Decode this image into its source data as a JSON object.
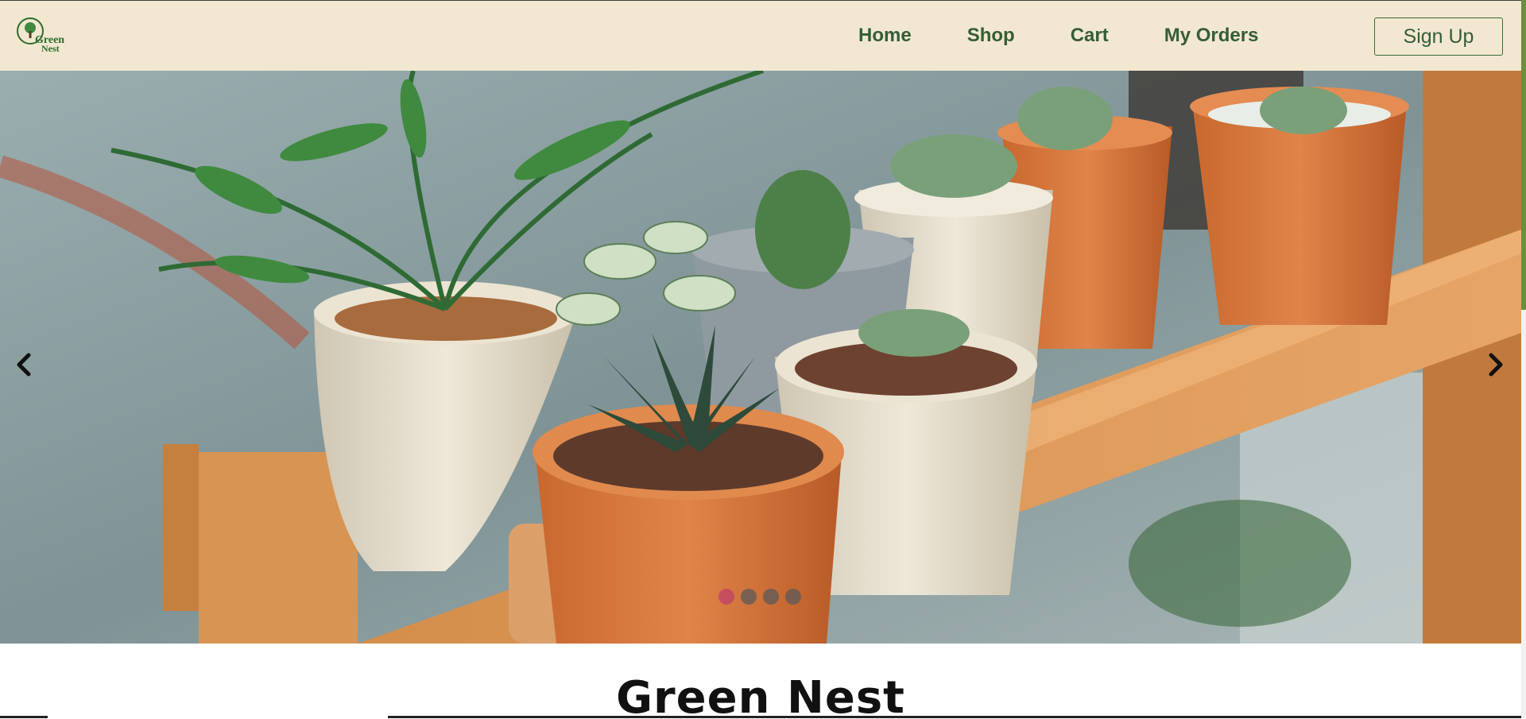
{
  "brand": {
    "logo_line1": "Green",
    "logo_line2": "Nest",
    "primary_color": "#355d35",
    "nav_bg": "#f2e8d1"
  },
  "nav": {
    "items": [
      {
        "label": "Home"
      },
      {
        "label": "Shop"
      },
      {
        "label": "Cart"
      },
      {
        "label": "My Orders"
      }
    ],
    "signup_label": "Sign Up"
  },
  "carousel": {
    "prev_icon": "chevron-left-icon",
    "next_icon": "chevron-right-icon",
    "slide_count": 4,
    "active_slide": 1,
    "active_dot_color": "#c54e5e"
  },
  "main": {
    "site_title": "Green Nest"
  }
}
